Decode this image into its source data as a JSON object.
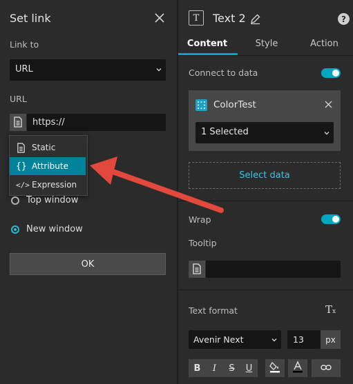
{
  "set_link": {
    "title": "Set link",
    "link_to_label": "Link to",
    "link_to_value": "URL",
    "url_label": "URL",
    "url_value": "https://",
    "menu": [
      {
        "label": "Static",
        "icon": "document-icon"
      },
      {
        "label": "Attribute",
        "icon": "braces-icon"
      },
      {
        "label": "Expression",
        "icon": "code-icon"
      }
    ],
    "target_options": [
      {
        "label": "Top window",
        "selected": false
      },
      {
        "label": "New window",
        "selected": true
      }
    ],
    "ok_label": "OK"
  },
  "widget": {
    "name": "Text 2",
    "tabs": [
      "Content",
      "Style",
      "Action"
    ],
    "active_tab": "Content",
    "connect_label": "Connect to data",
    "connect_on": true,
    "datasource_name": "ColorTest",
    "selection": "1 Selected",
    "select_data_label": "Select data",
    "wrap_label": "Wrap",
    "wrap_on": true,
    "tooltip_label": "Tooltip",
    "text_format_label": "Text format",
    "font": "Avenir Next",
    "font_size": "13",
    "font_unit": "px",
    "format_buttons": [
      "B",
      "I",
      "S",
      "U"
    ]
  },
  "colors": {
    "accent": "#00a6c2",
    "active_menu": "#00829b",
    "arrow": "#e2483b",
    "link": "#37c7e0"
  }
}
